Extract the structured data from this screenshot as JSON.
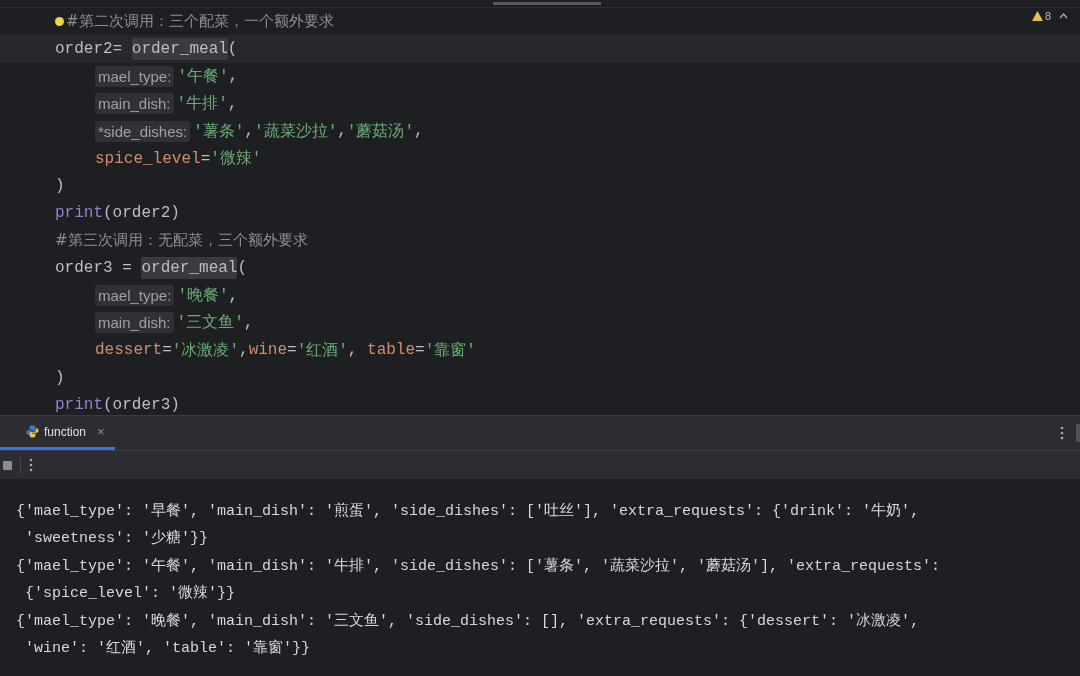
{
  "editor": {
    "warnings": {
      "count": "8"
    },
    "lines": [
      {
        "current": false,
        "indented": false,
        "tokens": [
          {
            "kind": "comment",
            "text": "#第二次调用：三个配菜，一个额外要求"
          }
        ],
        "bulb": true
      },
      {
        "current": true,
        "indented": false,
        "tokens": [
          {
            "kind": "plain",
            "text": "order2= "
          },
          {
            "kind": "call",
            "text": "order_meal"
          },
          {
            "kind": "plain",
            "text": "("
          }
        ]
      },
      {
        "current": false,
        "indented": true,
        "tokens": [
          {
            "kind": "hint",
            "text": "mael_type:"
          },
          {
            "kind": "string",
            "text": "'午餐'"
          },
          {
            "kind": "plain",
            "text": ","
          }
        ]
      },
      {
        "current": false,
        "indented": true,
        "tokens": [
          {
            "kind": "hint",
            "text": "main_dish:"
          },
          {
            "kind": "string",
            "text": "'牛排'"
          },
          {
            "kind": "plain",
            "text": ","
          }
        ]
      },
      {
        "current": false,
        "indented": true,
        "tokens": [
          {
            "kind": "hint",
            "text": "*side_dishes:"
          },
          {
            "kind": "string",
            "text": "'薯条'"
          },
          {
            "kind": "plain",
            "text": ","
          },
          {
            "kind": "string",
            "text": "'蔬菜沙拉'"
          },
          {
            "kind": "plain",
            "text": ","
          },
          {
            "kind": "string",
            "text": "'蘑菇汤'"
          },
          {
            "kind": "plain",
            "text": ","
          }
        ]
      },
      {
        "current": false,
        "indented": true,
        "tokens": [
          {
            "kind": "kwarg",
            "text": "spice_level"
          },
          {
            "kind": "plain",
            "text": "="
          },
          {
            "kind": "string",
            "text": "'微辣'"
          }
        ]
      },
      {
        "current": false,
        "indented": false,
        "tokens": [
          {
            "kind": "plain",
            "text": ")"
          }
        ]
      },
      {
        "current": false,
        "indented": false,
        "tokens": [
          {
            "kind": "builtin",
            "text": "print"
          },
          {
            "kind": "plain",
            "text": "(order2)"
          }
        ]
      },
      {
        "current": false,
        "indented": false,
        "tokens": [
          {
            "kind": "comment",
            "text": "#第三次调用：无配菜，三个额外要求"
          }
        ]
      },
      {
        "current": false,
        "indented": false,
        "tokens": [
          {
            "kind": "plain",
            "text": "order3 = "
          },
          {
            "kind": "call",
            "text": "order_meal"
          },
          {
            "kind": "plain",
            "text": "("
          }
        ]
      },
      {
        "current": false,
        "indented": true,
        "tokens": [
          {
            "kind": "hint",
            "text": "mael_type:"
          },
          {
            "kind": "string",
            "text": "'晚餐'"
          },
          {
            "kind": "plain",
            "text": ","
          }
        ]
      },
      {
        "current": false,
        "indented": true,
        "tokens": [
          {
            "kind": "hint",
            "text": "main_dish:"
          },
          {
            "kind": "string",
            "text": "'三文鱼'"
          },
          {
            "kind": "plain",
            "text": ","
          }
        ]
      },
      {
        "current": false,
        "indented": true,
        "tokens": [
          {
            "kind": "kwarg",
            "text": "dessert"
          },
          {
            "kind": "plain",
            "text": "="
          },
          {
            "kind": "string",
            "text": "'冰激凌'"
          },
          {
            "kind": "plain",
            "text": ","
          },
          {
            "kind": "kwarg",
            "text": "wine"
          },
          {
            "kind": "plain",
            "text": "="
          },
          {
            "kind": "string",
            "text": "'红酒'"
          },
          {
            "kind": "plain",
            "text": ", "
          },
          {
            "kind": "kwarg",
            "text": "table"
          },
          {
            "kind": "plain",
            "text": "="
          },
          {
            "kind": "string",
            "text": "'靠窗'"
          }
        ]
      },
      {
        "current": false,
        "indented": false,
        "tokens": [
          {
            "kind": "plain",
            "text": ")"
          }
        ]
      },
      {
        "current": false,
        "indented": false,
        "tokens": [
          {
            "kind": "builtin",
            "text": "print"
          },
          {
            "kind": "plain",
            "text": "(order3)"
          }
        ]
      }
    ]
  },
  "run_panel": {
    "tabs": [
      {
        "label": "function",
        "selected": true,
        "close": "×"
      }
    ],
    "output": [
      "{'mael_type': '早餐', 'main_dish': '煎蛋', 'side_dishes': ['吐丝'], 'extra_requests': {'drink': '牛奶',",
      " 'sweetness': '少糖'}}",
      "{'mael_type': '午餐', 'main_dish': '牛排', 'side_dishes': ['薯条', '蔬菜沙拉', '蘑菇汤'], 'extra_requests':",
      " {'spice_level': '微辣'}}",
      "{'mael_type': '晚餐', 'main_dish': '三文鱼', 'side_dishes': [], 'extra_requests': {'dessert': '冰激凌',",
      " 'wine': '红酒', 'table': '靠窗'}}"
    ]
  }
}
